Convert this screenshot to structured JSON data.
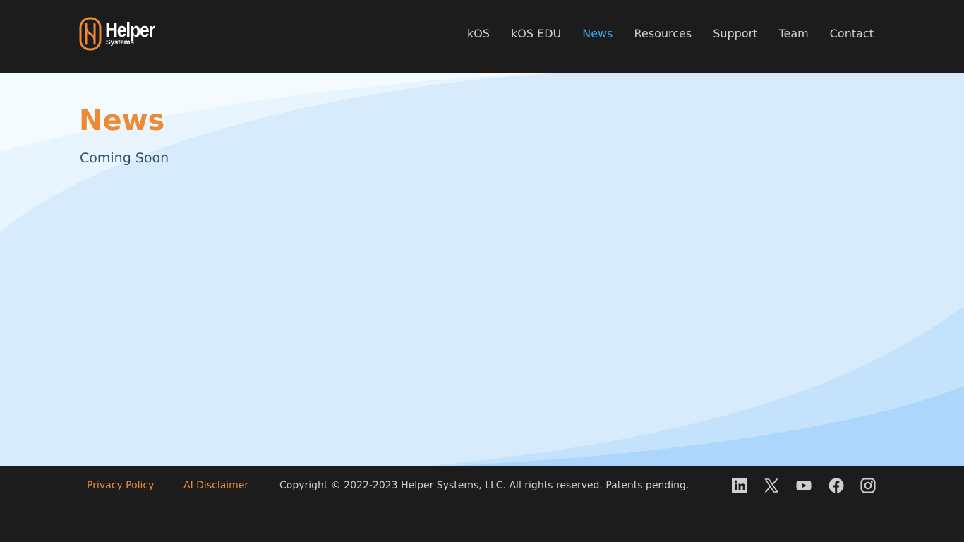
{
  "header": {
    "logo": {
      "word": "Helper",
      "sub": "Systems"
    },
    "nav": [
      {
        "label": "kOS",
        "active": false
      },
      {
        "label": "kOS EDU",
        "active": false
      },
      {
        "label": "News",
        "active": true
      },
      {
        "label": "Resources",
        "active": false
      },
      {
        "label": "Support",
        "active": false
      },
      {
        "label": "Team",
        "active": false
      },
      {
        "label": "Contact",
        "active": false
      }
    ]
  },
  "main": {
    "title": "News",
    "subtitle": "Coming Soon"
  },
  "footer": {
    "links": [
      {
        "label": "Privacy Policy"
      },
      {
        "label": "AI Disclaimer"
      }
    ],
    "copyright": "Copyright © 2022-2023 Helper Systems, LLC. All rights reserved. Patents pending.",
    "social": [
      "linkedin-icon",
      "x-icon",
      "youtube-icon",
      "facebook-icon",
      "instagram-icon"
    ]
  },
  "colors": {
    "accent": "#ee8a34",
    "nav_active": "#3ea5e8",
    "header_bg": "#1c1c1c",
    "main_bg": "#d7ebfc"
  }
}
